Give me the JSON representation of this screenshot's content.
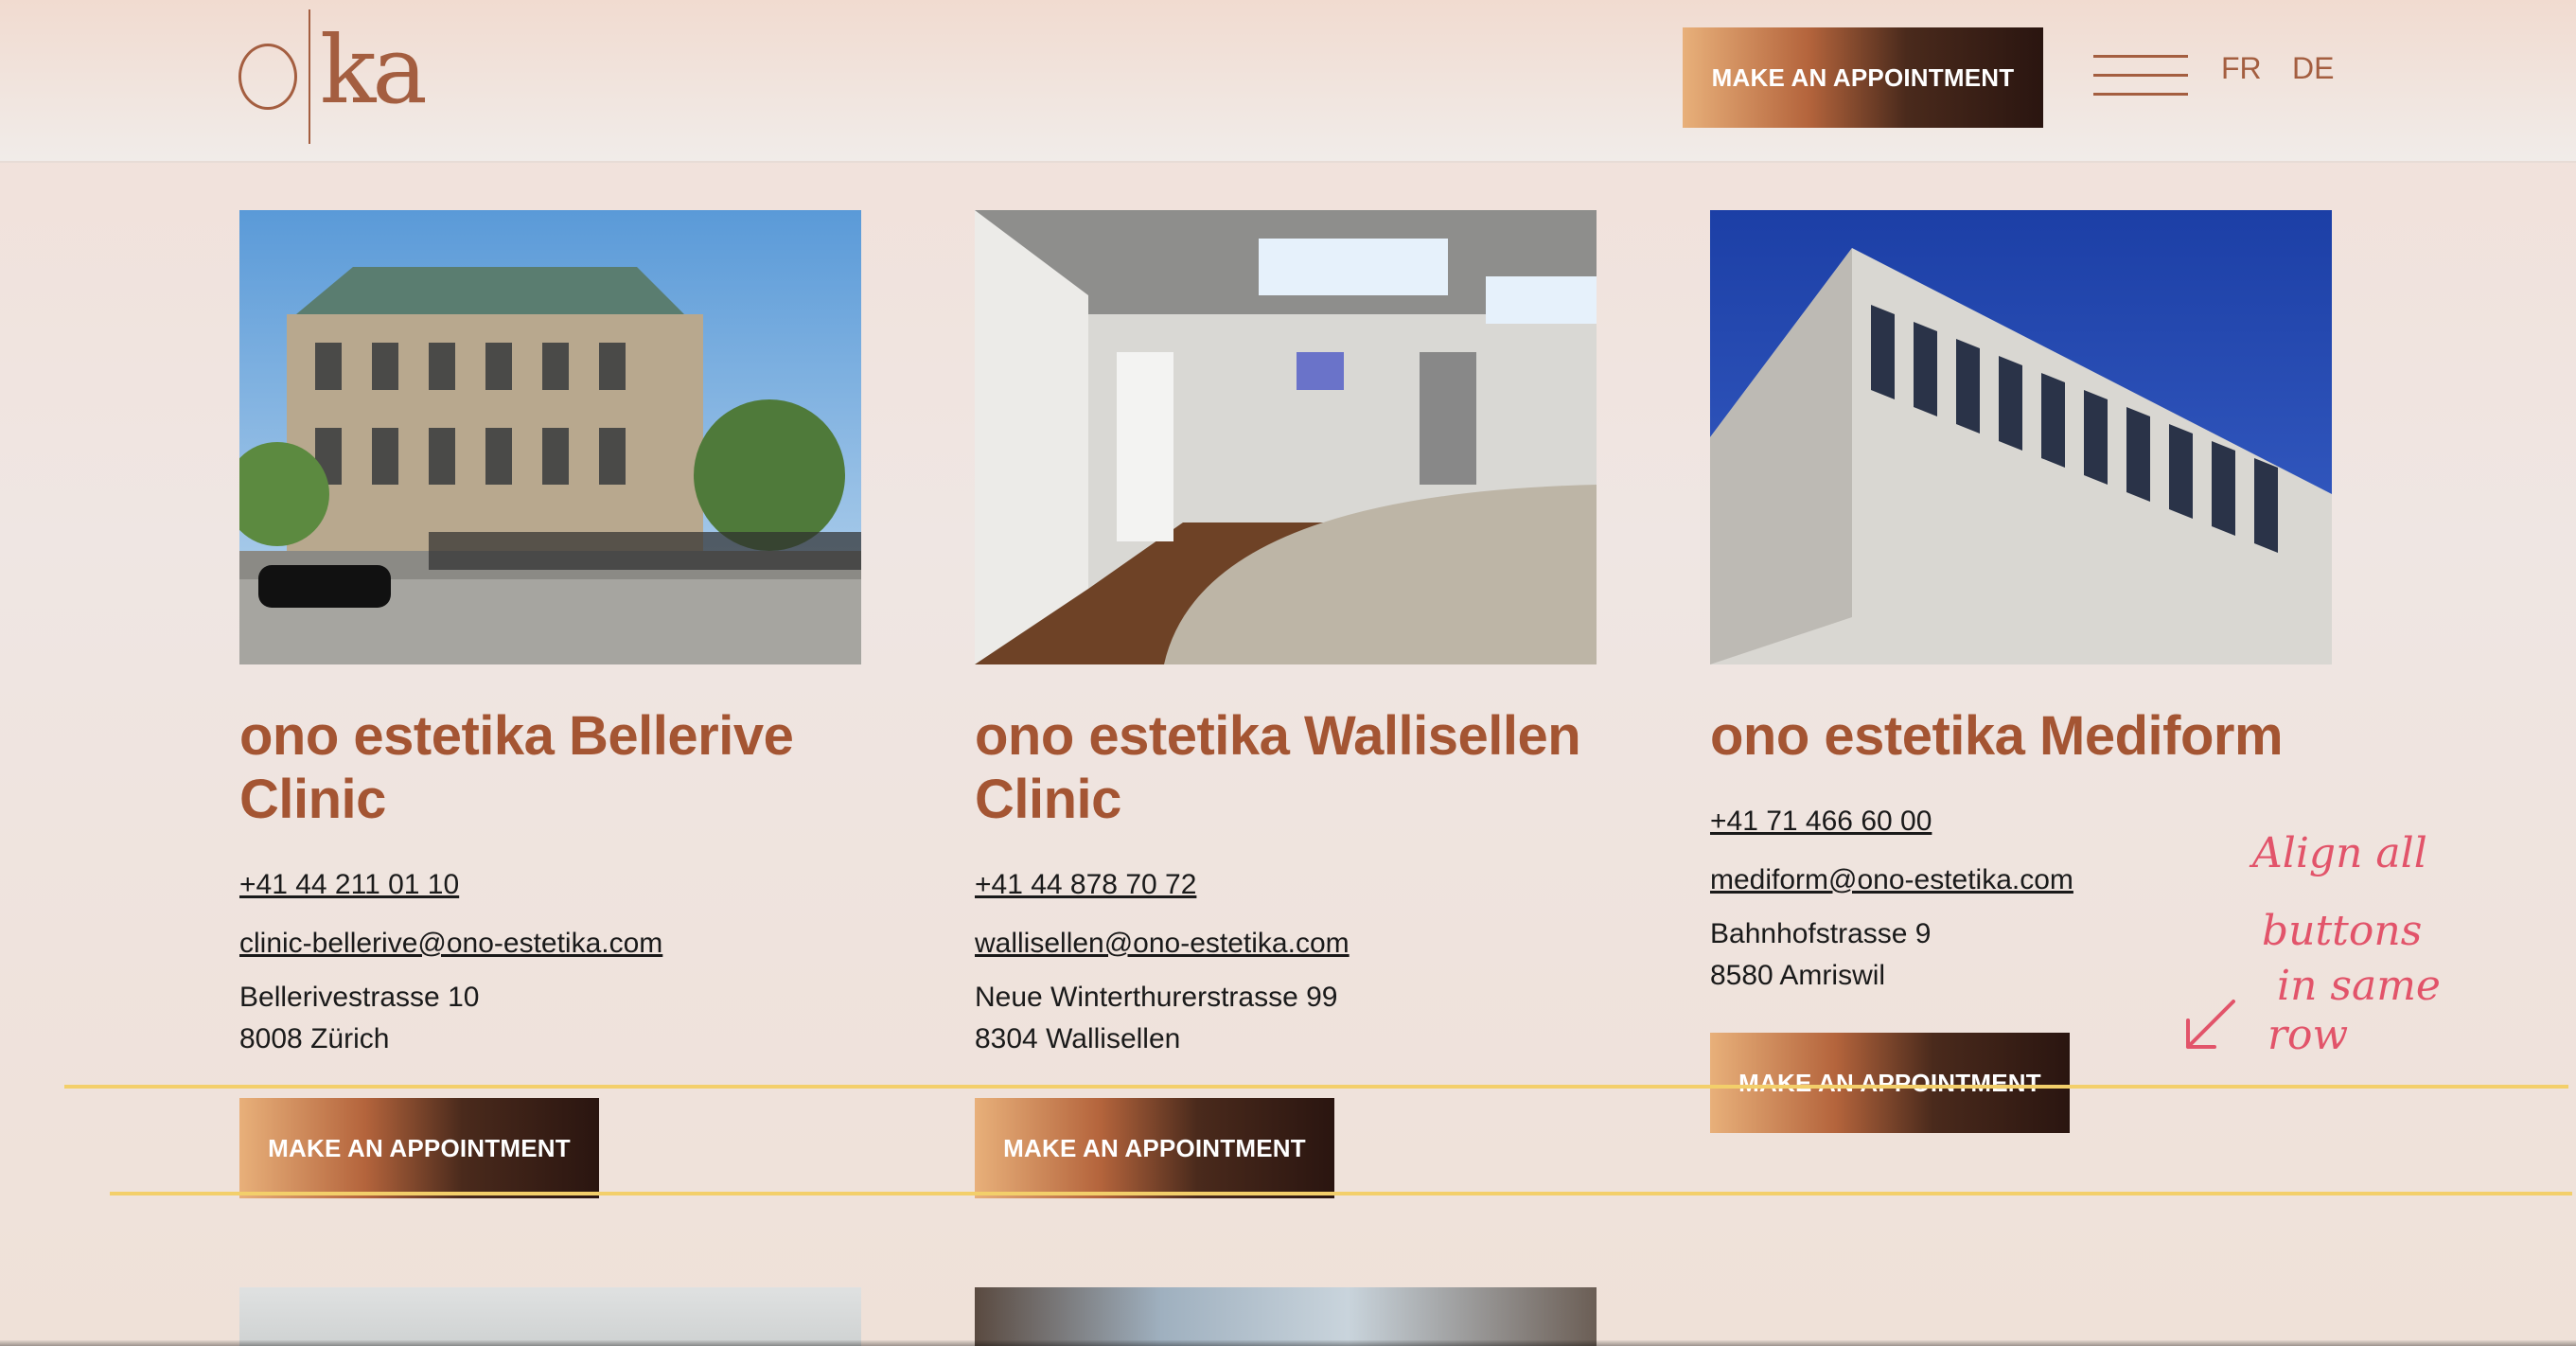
{
  "header": {
    "logo_text": "oka",
    "appointment_label": "MAKE AN APPOINTMENT",
    "lang_fr": "FR",
    "lang_de": "DE"
  },
  "clinics": [
    {
      "title": "ono estetika Bellerive Clinic",
      "phone": "+41 44 211 01 10",
      "email": "clinic-bellerive@ono-estetika.com",
      "street": "Bellerivestrasse 10",
      "city": "8008 Zürich",
      "button": "MAKE AN APPOINTMENT"
    },
    {
      "title": "ono estetika Wallisellen Clinic",
      "phone": "+41 44 878 70 72",
      "email": "wallisellen@ono-estetika.com",
      "street": "Neue Winterthurerstrasse 99",
      "city": "8304 Wallisellen",
      "button": "MAKE AN APPOINTMENT"
    },
    {
      "title": "ono estetika Mediform",
      "phone": "+41 71 466 60 00",
      "email": "mediform@ono-estetika.com",
      "street": "Bahnhofstrasse 9",
      "city": "8580 Amriswil",
      "button": "MAKE AN APPOINTMENT"
    }
  ],
  "annotation": {
    "line1": "Align all",
    "line2": "buttons",
    "line3": "in same",
    "line4": "row",
    "color": "#e2546a",
    "guide_color": "#f3cf6a"
  },
  "colors": {
    "accent": "#a45533",
    "button_gradient_start": "#e8b07a",
    "button_gradient_end": "#2a1510"
  }
}
